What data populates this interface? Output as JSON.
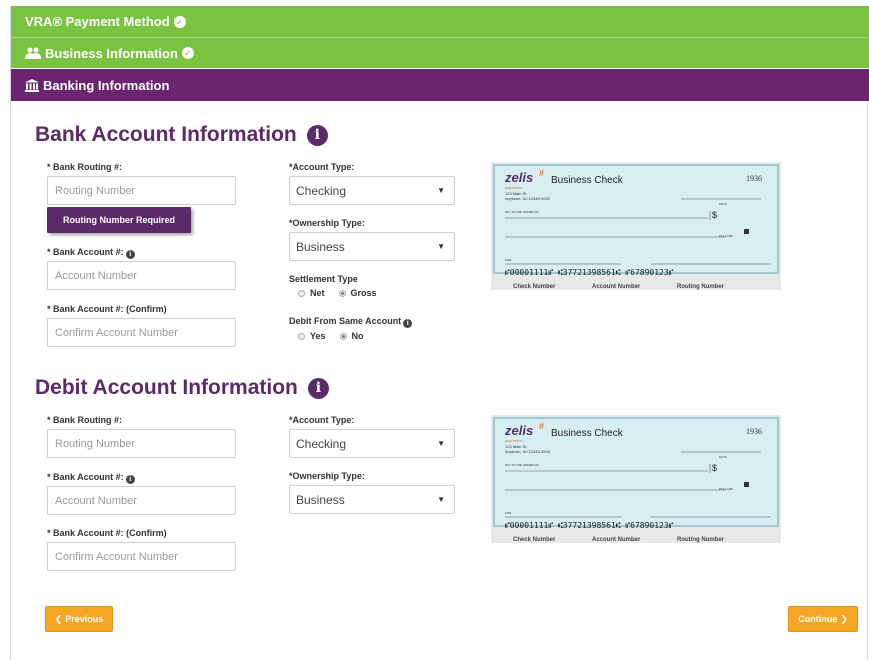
{
  "steps": {
    "payment_method": "VRA® Payment Method",
    "business_info": "Business Information",
    "banking_info": "Banking Information"
  },
  "bank_section": {
    "title": "Bank Account Information",
    "routing_label": "* Bank Routing #:",
    "routing_placeholder": "Routing Number",
    "routing_error": "Routing Number Required",
    "account_label": "* Bank Account #:",
    "account_placeholder": "Account Number",
    "confirm_label": "* Bank Account #: (Confirm)",
    "confirm_placeholder": "Confirm Account Number",
    "account_type_label": "*Account Type:",
    "account_type_value": "Checking",
    "ownership_label": "*Ownership Type:",
    "ownership_value": "Business",
    "settlement_label": "Settlement Type",
    "settlement_options": [
      "Net",
      "Gross"
    ],
    "settlement_selected": "Gross",
    "debit_same_label": "Debit From Same Account",
    "debit_same_options": [
      "Yes",
      "No"
    ],
    "debit_same_selected": "No"
  },
  "debit_section": {
    "title": "Debit Account Information",
    "routing_label": "* Bank Routing #:",
    "routing_placeholder": "Routing Number",
    "account_label": "* Bank Account #:",
    "account_placeholder": "Account Number",
    "confirm_label": "* Bank Account #: (Confirm)",
    "confirm_placeholder": "Confirm Account Number",
    "account_type_label": "*Account Type:",
    "account_type_value": "Checking",
    "ownership_label": "*Ownership Type:",
    "ownership_value": "Business"
  },
  "check_image": {
    "brand": "zelis",
    "brand_sub": "payments",
    "title": "Business Check",
    "number": "1936",
    "address_1": "123 Main St.",
    "address_2": "Anytown, NJ 12345-0000",
    "pay_to": "PAY TO THE ORDER OF",
    "dollar_sign": "$",
    "dollars": "DOLLARS",
    "date": "DATE",
    "for": "FOR",
    "micr": "⑈00001111⑈ ⑆37721398561⑆ ⑈67890123⑈",
    "caption_check": "Check Number",
    "caption_account": "Account Number",
    "caption_routing": "Routing Number"
  },
  "buttons": {
    "previous": "Previous",
    "continue": "Continue"
  },
  "colors": {
    "green": "#7bc142",
    "purple": "#6b2570",
    "heading": "#5b2a68",
    "button": "#f5a623",
    "check_bg": "#d7eef3"
  }
}
